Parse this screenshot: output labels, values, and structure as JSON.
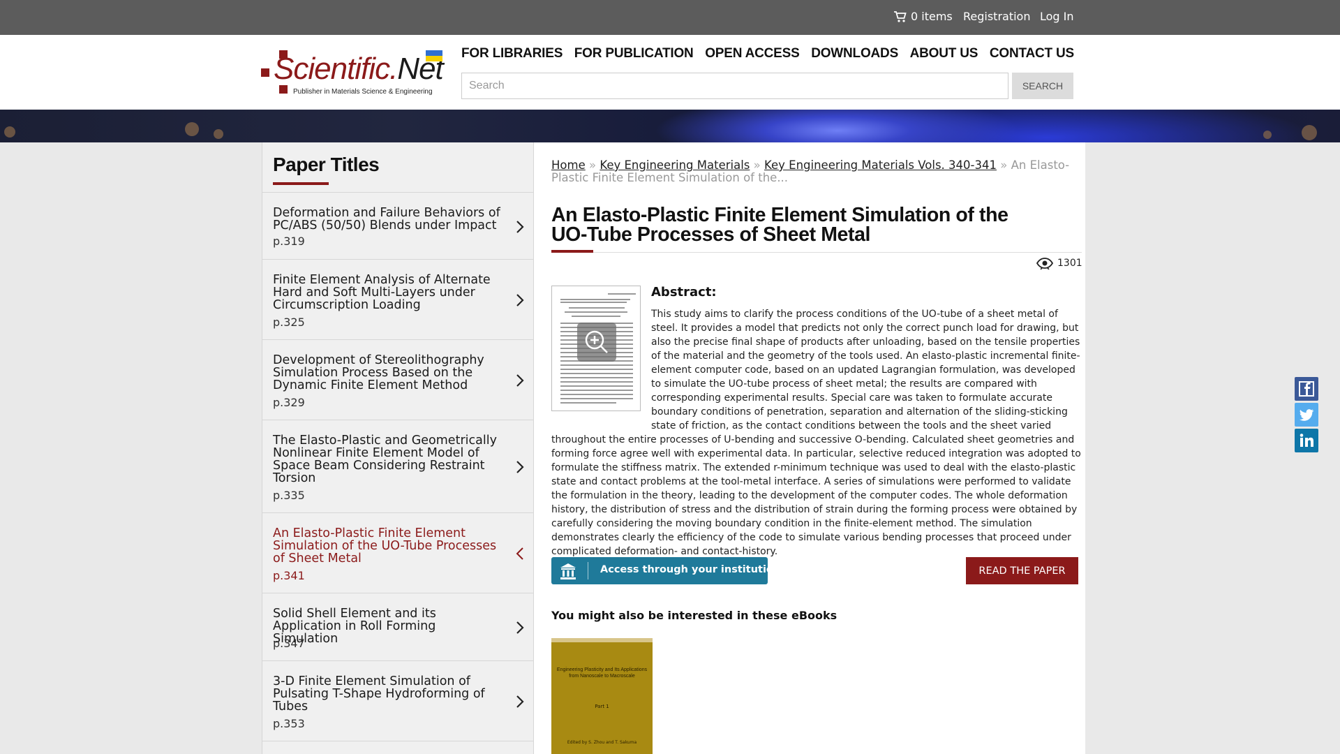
{
  "topbar": {
    "cart_label": "0 items",
    "registration": "Registration",
    "login": "Log In"
  },
  "logo": {
    "name_main": "Scientific.",
    "name_net": "Net",
    "tagline": "Publisher in Materials Science & Engineering"
  },
  "nav": {
    "items": [
      "FOR LIBRARIES",
      "FOR PUBLICATION",
      "OPEN ACCESS",
      "DOWNLOADS",
      "ABOUT US",
      "CONTACT US"
    ]
  },
  "search": {
    "placeholder": "Search",
    "button": "SEARCH"
  },
  "sidebar": {
    "title": "Paper Titles",
    "items": [
      {
        "title": "Deformation and Failure Behaviors of PC/ABS (50/50) Blends under Impact",
        "page": "p.319"
      },
      {
        "title": "Finite Element Analysis of Alternate Hard and Soft Multi-Layers under Circumscription Loading",
        "page": "p.325"
      },
      {
        "title": "Development of Stereolithography Simulation Process Based on the Dynamic Finite Element Method",
        "page": "p.329"
      },
      {
        "title": "The Elasto-Plastic and Geometrically Nonlinear Finite Element Model of Space Beam Considering Restraint Torsion",
        "page": "p.335"
      },
      {
        "title": "An Elasto-Plastic Finite Element Simulation of the UO-Tube Processes of Sheet Metal",
        "page": "p.341"
      },
      {
        "title": "Solid Shell Element and its Application in Roll Forming Simulation",
        "page": "p.347"
      },
      {
        "title": "3-D Finite Element Simulation of Pulsating T-Shape Hydroforming of Tubes",
        "page": "p.353"
      }
    ]
  },
  "breadcrumb": {
    "home": "Home",
    "journal": "Key Engineering Materials",
    "volume": "Key Engineering Materials Vols. 340-341",
    "current": "An Elasto-Plastic Finite Element Simulation of the..."
  },
  "paper": {
    "title": "An Elasto-Plastic Finite Element Simulation of the UO-Tube Processes of Sheet Metal",
    "views": "1301",
    "abstract_heading": "Abstract:",
    "abstract": "This study aims to clarify the process conditions of the UO-tube of a sheet metal of steel. It provides a model that predicts not only the correct punch load for drawing, but also the precise final shape of products after unloading, based on the tensile properties of the material and the geometry of the tools used. An elasto-plastic incremental finite-element computer code, based on an updated Lagrangian formulation, was developed to simulate the UO-tube process of sheet metal; the results are compared with corresponding experimental results. Special care was taken to formulate accurate boundary conditions of penetration, separation and alternation of the sliding-sticking state of friction, as the contact conditions between the tools and the sheet varied throughout the entire processes of U-bending and successive O-bending. Calculated sheet geometries and forming force agree well with experimental data. In particular, selective reduced integration was adopted to formulate the stiffness matrix. The extended r-minimum technique was used to deal with the elasto-plastic state and contact problems at the tool-metal interface. A series of simulations were performed to validate the formulation in the theory, leading to the development of the computer codes. The whole deformation history, the distribution of stress and the distribution of strain during the forming process were obtained by carefully considering the moving boundary condition in the finite-element method. The simulation demonstrates clearly the efficiency of the code to simulate various bending processes that proceed under complicated deformation- and contact-history.",
    "access_button": "Access through your institution",
    "read_button": "READ THE PAPER"
  },
  "ebooks": {
    "heading": "You might also be interested in these eBooks",
    "items": [
      {
        "title": "Engineering Plasticity and Its Applications from Nanoscale to Macroscale",
        "part": "Part 1",
        "editors": "Edited by S. Zhou and T. Sakuma"
      }
    ]
  },
  "colors": {
    "brand": "#8b1a1a",
    "topbar": "#5c5c5c",
    "access": "#1f7a9a"
  },
  "social": [
    "facebook-icon",
    "twitter-icon",
    "linkedin-icon"
  ]
}
